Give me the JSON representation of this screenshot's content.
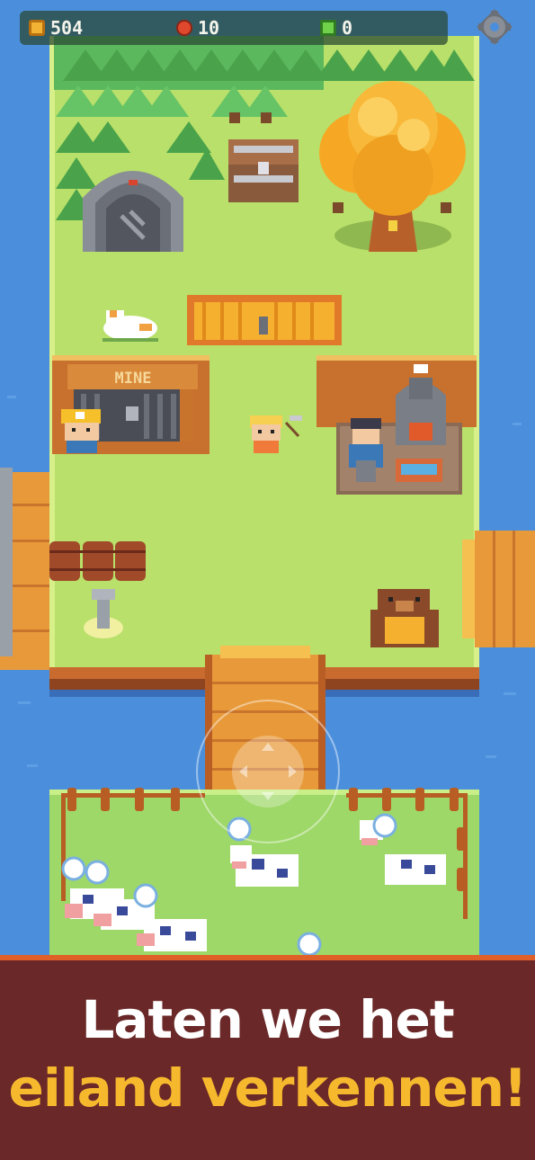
{
  "hud": {
    "coins": "504",
    "apples": "10",
    "gems": "0",
    "coin_icon": "coin-icon",
    "apple_icon": "apple-icon",
    "gem_icon": "gem-icon",
    "settings_icon": "gear-icon"
  },
  "scene": {
    "mine_sign": "MINE"
  },
  "banner": {
    "line1": "Laten we het",
    "line2": "eiland verkennen!"
  },
  "colors": {
    "water": "#4b8fdc",
    "grass": "#b8e06a",
    "banner_bg": "#6b2828",
    "banner_accent": "#f6b92e",
    "banner_border": "#e0602a"
  }
}
